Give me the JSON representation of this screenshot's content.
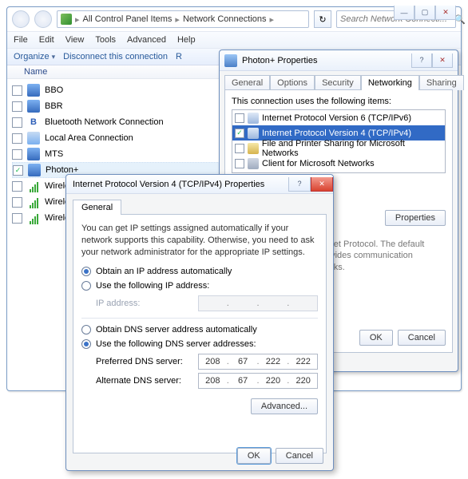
{
  "explorer": {
    "breadcrumb1": "All Control Panel Items",
    "breadcrumb2": "Network Connections",
    "search_placeholder": "Search Network Connecti...",
    "menu": {
      "file": "File",
      "edit": "Edit",
      "view": "View",
      "tools": "Tools",
      "advanced": "Advanced",
      "help": "Help"
    },
    "cmd": {
      "organize": "Organize",
      "disconnect": "Disconnect this connection",
      "rename": "R"
    },
    "col_name": "Name",
    "items": {
      "bbo": "BBO",
      "bbr": "BBR",
      "bt": "Bluetooth Network Connection",
      "lan": "Local Area Connection",
      "mts": "MTS",
      "photon": "Photon+",
      "w1": "Wireless N",
      "w2": "Wireless N",
      "w3": "Wireless N"
    }
  },
  "props": {
    "title": "Photon+ Properties",
    "tabs": {
      "general": "General",
      "options": "Options",
      "security": "Security",
      "networking": "Networking",
      "sharing": "Sharing"
    },
    "uses_label": "This connection uses the following items:",
    "items": {
      "ipv6": "Internet Protocol Version 6 (TCP/IPv6)",
      "ipv4": "Internet Protocol Version 4 (TCP/IPv4)",
      "fps": "File and Printer Sharing for Microsoft Networks",
      "client": "Client for Microsoft Networks"
    },
    "ipv6_checked": false,
    "ipv4_checked": true,
    "fps_checked": false,
    "client_checked": false,
    "props_btn": "Properties",
    "desc_partial": "rnet Protocol. The default\n ovides communication\norks.",
    "ok": "OK",
    "cancel": "Cancel"
  },
  "ipv4": {
    "title": "Internet Protocol Version 4 (TCP/IPv4) Properties",
    "tab_general": "General",
    "para": "You can get IP settings assigned automatically if your network supports this capability. Otherwise, you need to ask your network administrator for the appropriate IP settings.",
    "r_ip_auto": "Obtain an IP address automatically",
    "r_ip_manual": "Use the following IP address:",
    "ip_label": "IP address:",
    "r_dns_auto": "Obtain DNS server address automatically",
    "r_dns_manual": "Use the following DNS server addresses:",
    "pref_dns_label": "Preferred DNS server:",
    "alt_dns_label": "Alternate DNS server:",
    "pref_dns": {
      "a": "208",
      "b": "67",
      "c": "222",
      "d": "222"
    },
    "alt_dns": {
      "a": "208",
      "b": "67",
      "c": "220",
      "d": "220"
    },
    "advanced": "Advanced...",
    "ok": "OK",
    "cancel": "Cancel"
  }
}
